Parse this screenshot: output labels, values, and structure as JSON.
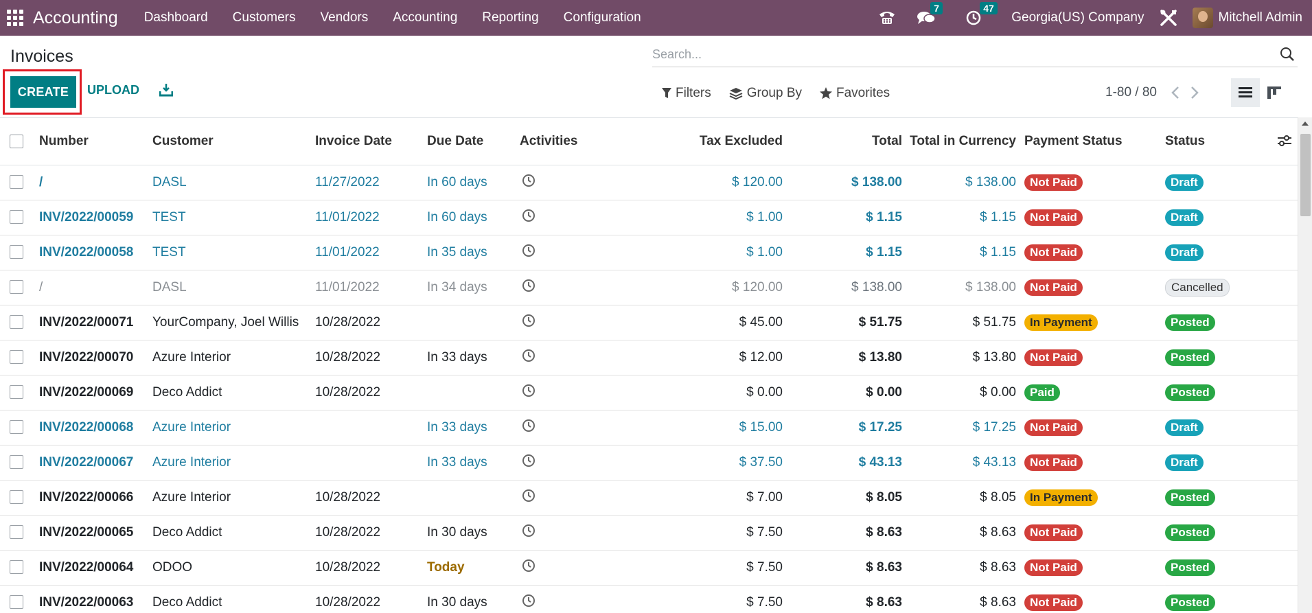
{
  "navbar": {
    "app_name": "Accounting",
    "menu": [
      "Dashboard",
      "Customers",
      "Vendors",
      "Accounting",
      "Reporting",
      "Configuration"
    ],
    "chat_count": "7",
    "activity_count": "47",
    "company": "Georgia(US) Company",
    "user": "Mitchell Admin",
    "bg_color": "#714b67"
  },
  "page": {
    "title": "Invoices",
    "create_label": "CREATE",
    "upload_label": "UPLOAD",
    "search_placeholder": "Search...",
    "filters_label": "Filters",
    "groupby_label": "Group By",
    "favorites_label": "Favorites",
    "pager": "1-80 / 80",
    "accent_color": "#017e84"
  },
  "table": {
    "columns": [
      "Number",
      "Customer",
      "Invoice Date",
      "Due Date",
      "Activities",
      "Tax Excluded",
      "Total",
      "Total in Currency",
      "Payment Status",
      "Status"
    ],
    "rows": [
      {
        "number": "/",
        "customer": "DASL",
        "invoice_date": "11/27/2022",
        "due_date": "In 60 days",
        "tax_excluded": "$ 120.00",
        "total": "$ 138.00",
        "total_currency": "$ 138.00",
        "payment_status": "Not Paid",
        "status": "Draft"
      },
      {
        "number": "INV/2022/00059",
        "customer": "TEST",
        "invoice_date": "11/01/2022",
        "due_date": "In 60 days",
        "tax_excluded": "$ 1.00",
        "total": "$ 1.15",
        "total_currency": "$ 1.15",
        "payment_status": "Not Paid",
        "status": "Draft"
      },
      {
        "number": "INV/2022/00058",
        "customer": "TEST",
        "invoice_date": "11/01/2022",
        "due_date": "In 35 days",
        "tax_excluded": "$ 1.00",
        "total": "$ 1.15",
        "total_currency": "$ 1.15",
        "payment_status": "Not Paid",
        "status": "Draft"
      },
      {
        "number": "/",
        "customer": "DASL",
        "invoice_date": "11/01/2022",
        "due_date": "In 34 days",
        "tax_excluded": "$ 120.00",
        "total": "$ 138.00",
        "total_currency": "$ 138.00",
        "payment_status": "Not Paid",
        "status": "Cancelled"
      },
      {
        "number": "INV/2022/00071",
        "customer": "YourCompany, Joel Willis",
        "invoice_date": "10/28/2022",
        "due_date": "",
        "tax_excluded": "$ 45.00",
        "total": "$ 51.75",
        "total_currency": "$ 51.75",
        "payment_status": "In Payment",
        "status": "Posted"
      },
      {
        "number": "INV/2022/00070",
        "customer": "Azure Interior",
        "invoice_date": "10/28/2022",
        "due_date": "In 33 days",
        "tax_excluded": "$ 12.00",
        "total": "$ 13.80",
        "total_currency": "$ 13.80",
        "payment_status": "Not Paid",
        "status": "Posted"
      },
      {
        "number": "INV/2022/00069",
        "customer": "Deco Addict",
        "invoice_date": "10/28/2022",
        "due_date": "",
        "tax_excluded": "$ 0.00",
        "total": "$ 0.00",
        "total_currency": "$ 0.00",
        "payment_status": "Paid",
        "status": "Posted"
      },
      {
        "number": "INV/2022/00068",
        "customer": "Azure Interior",
        "invoice_date": "",
        "due_date": "In 33 days",
        "tax_excluded": "$ 15.00",
        "total": "$ 17.25",
        "total_currency": "$ 17.25",
        "payment_status": "Not Paid",
        "status": "Draft"
      },
      {
        "number": "INV/2022/00067",
        "customer": "Azure Interior",
        "invoice_date": "",
        "due_date": "In 33 days",
        "tax_excluded": "$ 37.50",
        "total": "$ 43.13",
        "total_currency": "$ 43.13",
        "payment_status": "Not Paid",
        "status": "Draft"
      },
      {
        "number": "INV/2022/00066",
        "customer": "Azure Interior",
        "invoice_date": "10/28/2022",
        "due_date": "",
        "tax_excluded": "$ 7.00",
        "total": "$ 8.05",
        "total_currency": "$ 8.05",
        "payment_status": "In Payment",
        "status": "Posted"
      },
      {
        "number": "INV/2022/00065",
        "customer": "Deco Addict",
        "invoice_date": "10/28/2022",
        "due_date": "In 30 days",
        "tax_excluded": "$ 7.50",
        "total": "$ 8.63",
        "total_currency": "$ 8.63",
        "payment_status": "Not Paid",
        "status": "Posted"
      },
      {
        "number": "INV/2022/00064",
        "customer": "ODOO",
        "invoice_date": "10/28/2022",
        "due_date": "Today",
        "tax_excluded": "$ 7.50",
        "total": "$ 8.63",
        "total_currency": "$ 8.63",
        "payment_status": "Not Paid",
        "status": "Posted"
      },
      {
        "number": "INV/2022/00063",
        "customer": "Deco Addict",
        "invoice_date": "10/28/2022",
        "due_date": "In 30 days",
        "tax_excluded": "$ 7.50",
        "total": "$ 8.63",
        "total_currency": "$ 8.63",
        "payment_status": "Not Paid",
        "status": "Posted"
      }
    ]
  },
  "status_colors": {
    "Not Paid": "#d23f3a",
    "In Payment": "#f3b000",
    "Paid": "#28a745",
    "Draft": "#17a2b8",
    "Posted": "#28a745",
    "Cancelled": "#e9ecef"
  }
}
